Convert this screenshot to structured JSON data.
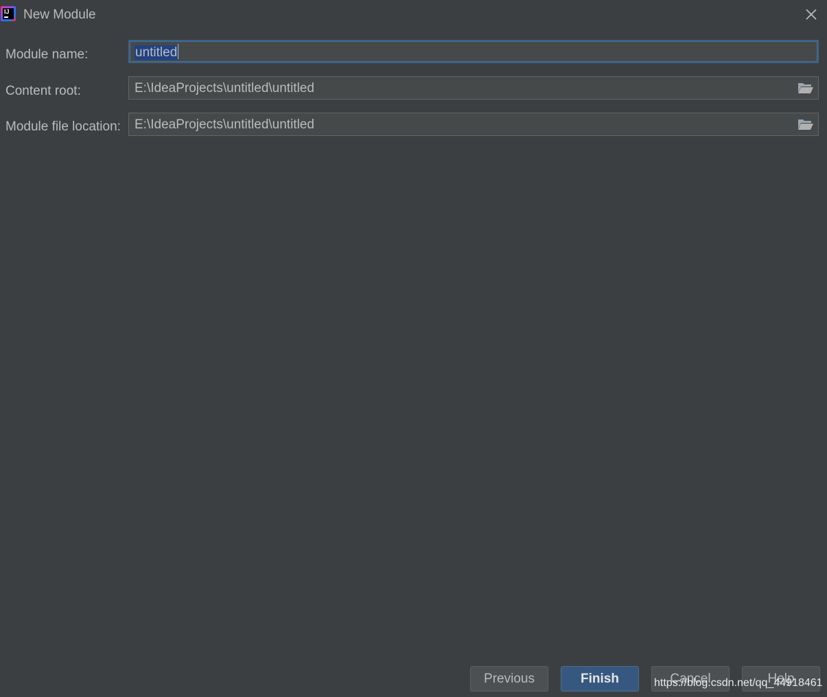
{
  "window": {
    "title": "New Module",
    "app_icon": "intellij-idea-icon",
    "close_icon": "close-icon"
  },
  "form": {
    "module_name": {
      "label": "Module name:",
      "value": "untitled"
    },
    "content_root": {
      "label": "Content root:",
      "value": "E:\\IdeaProjects\\untitled\\untitled",
      "browse_icon": "folder-icon"
    },
    "module_file_location": {
      "label": "Module file location:",
      "value": "E:\\IdeaProjects\\untitled\\untitled",
      "browse_icon": "folder-icon"
    }
  },
  "buttons": {
    "previous": "Previous",
    "finish": "Finish",
    "cancel": "Cancel",
    "help": "Help"
  },
  "watermark": "https://blog.csdn.net/qq_44918461",
  "colors": {
    "background": "#3c3f41",
    "field_background": "#45494a",
    "focus_border": "#3d6185",
    "selection": "#214283",
    "primary_button": "#365880",
    "text": "#bbbbbb"
  }
}
